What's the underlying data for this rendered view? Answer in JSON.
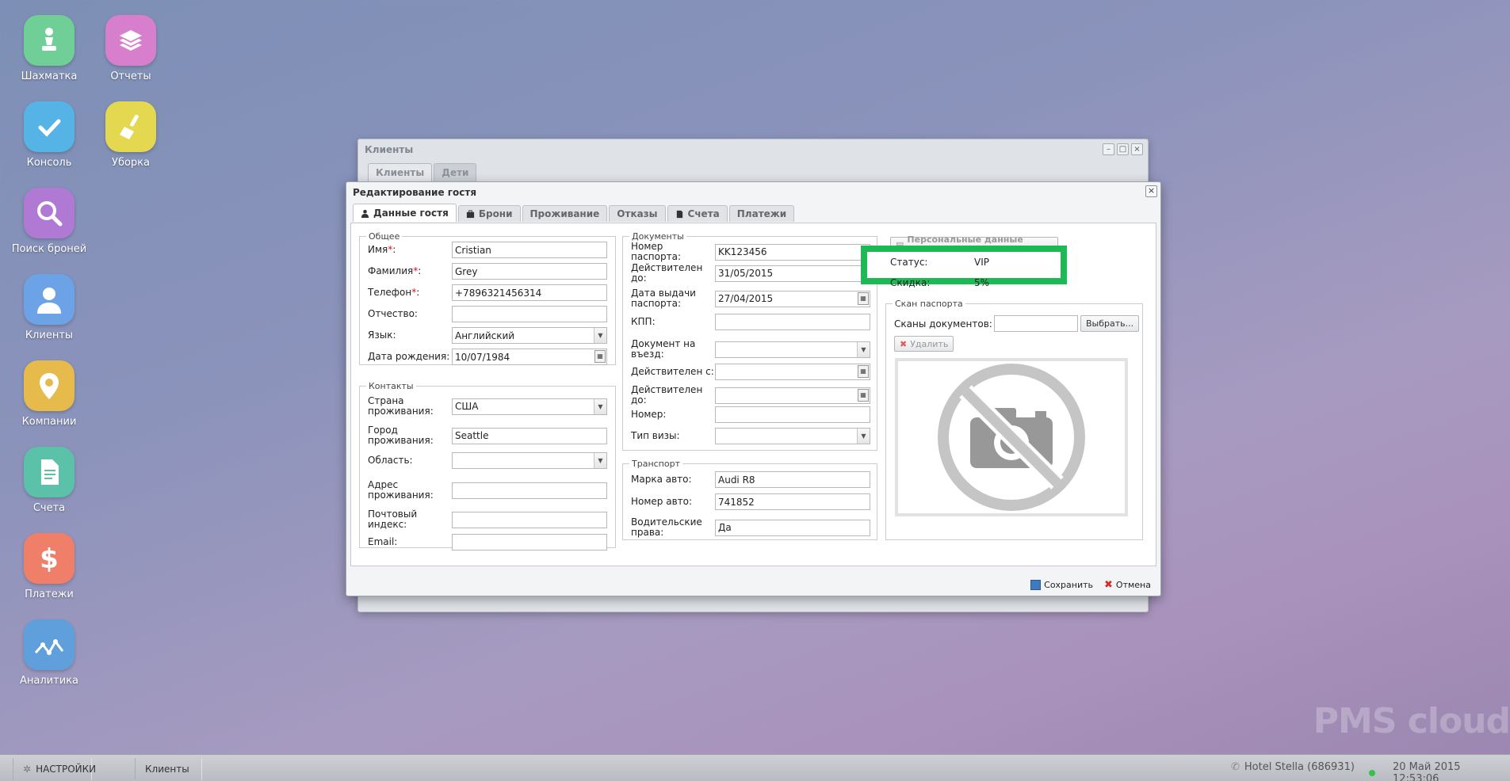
{
  "desktop_icons": [
    {
      "label": "Шахматка",
      "icon": "chess-pawn-icon",
      "color": "#6fcf97"
    },
    {
      "label": "Отчеты",
      "icon": "stack-icon",
      "color": "#d77fcd"
    },
    {
      "label": "Консоль",
      "icon": "checkmark-icon",
      "color": "#56b3e6"
    },
    {
      "label": "Уборка",
      "icon": "broom-icon",
      "color": "#e3d84f"
    },
    {
      "label": "Поиск броней",
      "icon": "magnifier-icon",
      "color": "#b07ad4"
    },
    {
      "label": "Клиенты",
      "icon": "person-icon",
      "color": "#6ca2e6"
    },
    {
      "label": "Компании",
      "icon": "map-pin-icon",
      "color": "#e6bb4b"
    },
    {
      "label": "Счета",
      "icon": "document-icon",
      "color": "#5cc1a9"
    },
    {
      "label": "Платежи",
      "icon": "dollar-icon",
      "color": "#ef7f68"
    },
    {
      "label": "Аналитика",
      "icon": "line-chart-icon",
      "color": "#5fa0dc"
    }
  ],
  "bg_window": {
    "title": "Клиенты",
    "tabs": [
      "Клиенты",
      "Дети"
    ]
  },
  "dialog": {
    "title": "Редактирование гостя",
    "tabs": [
      "Данные гостя",
      "Брони",
      "Проживание",
      "Отказы",
      "Счета",
      "Платежи"
    ],
    "general": {
      "legend": "Общее",
      "name_label": "Имя",
      "name_value": "Cristian",
      "surname_label": "Фамилия",
      "surname_value": "Grey",
      "phone_label": "Телефон",
      "phone_value": "+7896321456314",
      "patronymic_label": "Отчество:",
      "patronymic_value": "",
      "language_label": "Язык:",
      "language_value": "Английский",
      "birthdate_label": "Дата рождения:",
      "birthdate_value": "10/07/1984",
      "required_mark": "*",
      "colon": ":"
    },
    "contacts": {
      "legend": "Контакты",
      "country_label": "Страна проживания:",
      "country_value": "США",
      "city_label": "Город проживания:",
      "city_value": "Seattle",
      "region_label": "Область:",
      "region_value": "",
      "address_label": "Адрес проживания:",
      "address_value": "",
      "zip_label": "Почтовый индекс:",
      "zip_value": "",
      "email_label": "Email:",
      "email_value": ""
    },
    "documents": {
      "legend": "Документы",
      "passport_label": "Номер паспорта:",
      "passport_value": "KK123456",
      "valid_to_label": "Действителен до:",
      "valid_to_value": "31/05/2015",
      "issue_date_label": "Дата выдачи паспорта:",
      "issue_date_value": "27/04/2015",
      "kpp_label": "КПП:",
      "kpp_value": "",
      "entry_doc_label": "Документ на въезд:",
      "entry_doc_value": "",
      "valid_from_label": "Действителен с:",
      "valid_from_value": "",
      "valid_to2_label": "Действителен до:",
      "valid_to2_value": "",
      "number_label": "Номер:",
      "number_value": "",
      "visa_type_label": "Тип визы:",
      "visa_type_value": ""
    },
    "transport": {
      "legend": "Транспорт",
      "car_brand_label": "Марка авто:",
      "car_brand_value": "Audi R8",
      "car_number_label": "Номер авто:",
      "car_number_value": "741852",
      "license_label": "Водительские права:",
      "license_value": "Да"
    },
    "client": {
      "personal_data_button": "Персональные данные клиента",
      "status_label": "Статус:",
      "status_value": "VIP",
      "discount_label": "Скидка:",
      "discount_value": "5%",
      "highlight_color": "#1db954"
    },
    "passport_scan": {
      "legend": "Скан паспорта",
      "scans_label": "Сканы документов:",
      "scans_value": "",
      "choose_button": "Выбрать...",
      "delete_button": "Удалить",
      "placeholder_icon": "no-photo-icon"
    },
    "footer": {
      "save_label": "Сохранить",
      "cancel_label": "Отмена"
    }
  },
  "taskbar": {
    "settings_label": "НАСТРОЙКИ",
    "open_window_label": "Клиенты",
    "hotel_label": "Hotel Stella (686931)",
    "datetime": "20 Май 2015 12:53:06",
    "status_color": "#35c24a"
  },
  "watermark": "PMS cloud"
}
